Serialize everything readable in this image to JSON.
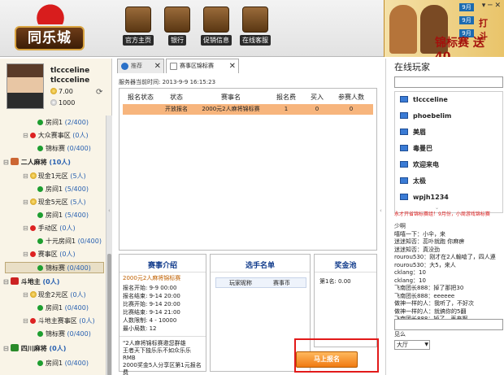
{
  "header": {
    "logo_text": "同乐城",
    "nav": [
      {
        "label": "官方主页",
        "icon": "house-icon"
      },
      {
        "label": "银行",
        "icon": "bank-icon"
      },
      {
        "label": "促销信息",
        "icon": "promo-icon"
      },
      {
        "label": "在线客服",
        "icon": "support-icon"
      }
    ],
    "banner": {
      "title": "锦标赛 送 40",
      "dates": [
        "9月",
        "9月",
        "9月"
      ],
      "lines": [
        "打",
        "斗"
      ]
    },
    "window_controls": "▾ ─ ✕"
  },
  "profile": {
    "name": "tlccceline",
    "nickname": "tlccceline",
    "gold": "7.00",
    "silver": "1000"
  },
  "tree": [
    {
      "label": "房间1",
      "count": "(2/400)",
      "type": "room"
    },
    {
      "label": "大众赛事区",
      "count": "(0人)",
      "type": "zone"
    },
    {
      "label": "锦标赛",
      "count": "(0/400)",
      "type": "room-plain"
    },
    {
      "label": "二人麻将",
      "count": "(10人)",
      "type": "game"
    },
    {
      "label": "现金1元区",
      "count": "(5人)",
      "type": "zone"
    },
    {
      "label": "房间1",
      "count": "(5/400)",
      "type": "room"
    },
    {
      "label": "现金5元区",
      "count": "(5人)",
      "type": "zone"
    },
    {
      "label": "房间1",
      "count": "(5/400)",
      "type": "room"
    },
    {
      "label": "手动区",
      "count": "(0人)",
      "type": "zone"
    },
    {
      "label": "十元房间1",
      "count": "(0/400)",
      "type": "room"
    },
    {
      "label": "赛事区",
      "count": "(0人)",
      "type": "zone"
    },
    {
      "label": "锦标赛",
      "count": "(0/400)",
      "type": "room-selected"
    },
    {
      "label": "斗地主",
      "count": "(0人)",
      "type": "game"
    },
    {
      "label": "现金2元区",
      "count": "(0人)",
      "type": "zone"
    },
    {
      "label": "房间1",
      "count": "(0/400)",
      "type": "room"
    },
    {
      "label": "斗地主赛事区",
      "count": "(0人)",
      "type": "zone"
    },
    {
      "label": "锦标赛",
      "count": "(0/400)",
      "type": "room"
    },
    {
      "label": "四川麻将",
      "count": "(0人)",
      "type": "game"
    },
    {
      "label": "房间1",
      "count": "(0/400)",
      "type": "room"
    }
  ],
  "tabs": [
    {
      "label": "推荐",
      "icon": "globe-icon"
    },
    {
      "label": "赛事区锦标赛",
      "icon": "document-icon"
    }
  ],
  "server_time": {
    "label": "服务器当前时间:",
    "value": "2013-9-9 16:15:23"
  },
  "match_table": {
    "headers": [
      "报名状态",
      "状态",
      "赛事名",
      "报名费",
      "买入",
      "参赛人数"
    ],
    "rows": [
      [
        "",
        "开放报名",
        "2000元2人麻将锦标赛",
        "1",
        "0",
        "0"
      ]
    ]
  },
  "intro": {
    "title": "赛事介绍",
    "subtitle": "2000元2人麻将锦标赛",
    "rows": [
      "报名开始: 9-9 00:00",
      "报名结束: 9-14 20:00",
      "比赛开始: 9-14 20:00",
      "比赛结束: 9-14 21:00",
      "人数限制: 4 - 10000",
      "最小局数: 12"
    ],
    "note_lines": [
      "\"2人麻将锦标赛邀您群雄",
      "王者天下独乐乐不如众乐乐RMB",
      "2000奖金5人分享区第1元报名费"
    ]
  },
  "players": {
    "title": "选手名单",
    "headers": [
      "玩家昵称",
      "赛事币"
    ]
  },
  "prize": {
    "title": "奖金池",
    "line": "第1名: 0.00"
  },
  "signup_button": "马上报名",
  "online": {
    "title": "在线玩家",
    "users": [
      "tlccceline",
      "phoebelim",
      "美眉",
      "毒曼巴",
      "欢迎来电",
      "太极",
      "wpjh1234"
    ]
  },
  "ticker": "永才开省锦标赛组！9月份，小周游戏锦标赛",
  "chat": [
    "少啊",
    "嘻嘻一下：小伞，来",
    "迷迷知否：蕊卟就跑 你麻痹",
    "迷迷知否：真没劲",
    "rourou530：刚才在2人輸嗆了，四人連",
    "rourou530：大5，来人",
    "cklang：10",
    "cklang：10",
    "飞南团长888：掉了那把30",
    "飞南团长888：eeeeee",
    "做神一样的人：我听了，不好次",
    "做神一样的人：就搞你的5翻",
    "飞南团长888：掉了，再来啊",
    "做神一样的人：我要3荀，你就掉3荀，我",
    "见么"
  ],
  "chat_scope": "大厅"
}
